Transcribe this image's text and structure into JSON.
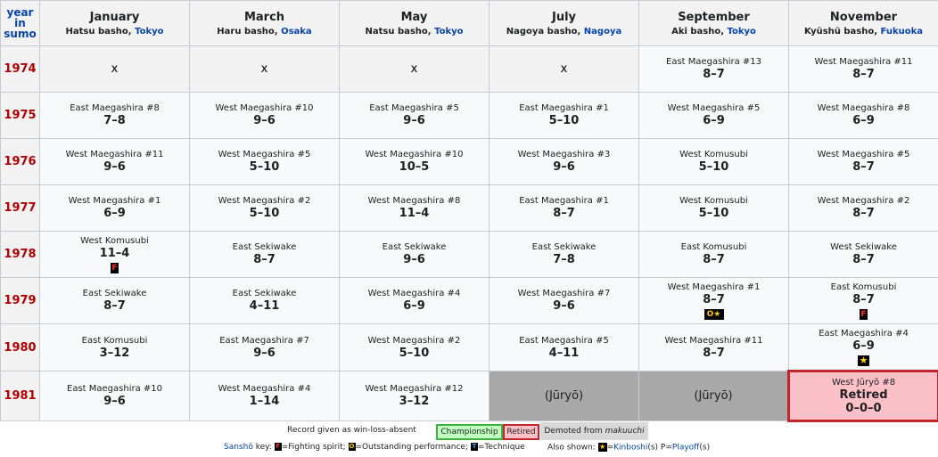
{
  "header": {
    "year_line1": "year",
    "year_line2": "in",
    "year_line3": "sumo",
    "months": [
      {
        "name": "January",
        "basho": "Hatsu basho, ",
        "venue": "Tokyo"
      },
      {
        "name": "March",
        "basho": "Haru basho, ",
        "venue": "Osaka"
      },
      {
        "name": "May",
        "basho": "Natsu basho, ",
        "venue": "Tokyo"
      },
      {
        "name": "July",
        "basho": "Nagoya basho, ",
        "venue": "Nagoya"
      },
      {
        "name": "September",
        "basho": "Aki basho, ",
        "venue": "Tokyo"
      },
      {
        "name": "November",
        "basho": "Kyūshū basho, ",
        "venue": "Fukuoka"
      }
    ]
  },
  "rows": [
    {
      "year": "1974",
      "cells": [
        {
          "type": "absent",
          "mark": "x"
        },
        {
          "type": "absent",
          "mark": "x"
        },
        {
          "type": "absent",
          "mark": "x"
        },
        {
          "type": "absent",
          "mark": "x"
        },
        {
          "type": "normal",
          "rank": "East Maegashira #13",
          "score": "8–7"
        },
        {
          "type": "normal",
          "rank": "West Maegashira #11",
          "score": "8–7"
        }
      ]
    },
    {
      "year": "1975",
      "cells": [
        {
          "type": "normal",
          "rank": "East Maegashira #8",
          "score": "7–8"
        },
        {
          "type": "normal",
          "rank": "West Maegashira #10",
          "score": "9–6"
        },
        {
          "type": "normal",
          "rank": "East Maegashira #5",
          "score": "9–6"
        },
        {
          "type": "normal",
          "rank": "East Maegashira #1",
          "score": "5–10"
        },
        {
          "type": "normal",
          "rank": "West Maegashira #5",
          "score": "6–9"
        },
        {
          "type": "normal",
          "rank": "West Maegashira #8",
          "score": "6–9"
        }
      ]
    },
    {
      "year": "1976",
      "cells": [
        {
          "type": "normal",
          "rank": "West Maegashira #11",
          "score": "9–6"
        },
        {
          "type": "normal",
          "rank": "West Maegashira #5",
          "score": "5–10"
        },
        {
          "type": "normal",
          "rank": "West Maegashira #10",
          "score": "10–5"
        },
        {
          "type": "normal",
          "rank": "West Maegashira #3",
          "score": "9–6"
        },
        {
          "type": "normal",
          "rank": "West Komusubi",
          "score": "5–10"
        },
        {
          "type": "normal",
          "rank": "West Maegashira #5",
          "score": "8–7"
        }
      ]
    },
    {
      "year": "1977",
      "cells": [
        {
          "type": "normal",
          "rank": "West Maegashira #1",
          "score": "6–9"
        },
        {
          "type": "normal",
          "rank": "West Maegashira #2",
          "score": "5–10"
        },
        {
          "type": "normal",
          "rank": "West Maegashira #8",
          "score": "11–4"
        },
        {
          "type": "normal",
          "rank": "East Maegashira #1",
          "score": "8–7"
        },
        {
          "type": "normal",
          "rank": "West Komusubi",
          "score": "5–10"
        },
        {
          "type": "normal",
          "rank": "West Maegashira #2",
          "score": "8–7"
        }
      ]
    },
    {
      "year": "1978",
      "cells": [
        {
          "type": "normal",
          "rank": "West Komusubi",
          "score": "11–4",
          "badge": "F"
        },
        {
          "type": "normal",
          "rank": "East Sekiwake",
          "score": "8–7"
        },
        {
          "type": "normal",
          "rank": "East Sekiwake",
          "score": "9–6"
        },
        {
          "type": "normal",
          "rank": "East Sekiwake",
          "score": "7–8"
        },
        {
          "type": "normal",
          "rank": "East Komusubi",
          "score": "8–7"
        },
        {
          "type": "normal",
          "rank": "West Sekiwake",
          "score": "8–7"
        }
      ]
    },
    {
      "year": "1979",
      "cells": [
        {
          "type": "normal",
          "rank": "East Sekiwake",
          "score": "8–7"
        },
        {
          "type": "normal",
          "rank": "East Sekiwake",
          "score": "4–11"
        },
        {
          "type": "normal",
          "rank": "West Maegashira #4",
          "score": "6–9"
        },
        {
          "type": "normal",
          "rank": "West Maegashira #7",
          "score": "9–6"
        },
        {
          "type": "normal",
          "rank": "West Maegashira #1",
          "score": "8–7",
          "badge": "O★"
        },
        {
          "type": "normal",
          "rank": "East Komusubi",
          "score": "8–7",
          "badge": "F"
        }
      ]
    },
    {
      "year": "1980",
      "cells": [
        {
          "type": "normal",
          "rank": "East Komusubi",
          "score": "3–12"
        },
        {
          "type": "normal",
          "rank": "East Maegashira #7",
          "score": "9–6"
        },
        {
          "type": "normal",
          "rank": "West Maegashira #2",
          "score": "5–10"
        },
        {
          "type": "normal",
          "rank": "East Maegashira #5",
          "score": "4–11"
        },
        {
          "type": "normal",
          "rank": "West Maegashira #11",
          "score": "8–7"
        },
        {
          "type": "normal",
          "rank": "East Maegashira #4",
          "score": "6–9",
          "badge": "★"
        }
      ]
    },
    {
      "year": "1981",
      "cells": [
        {
          "type": "normal",
          "rank": "East Maegashira #10",
          "score": "9–6"
        },
        {
          "type": "normal",
          "rank": "West Maegashira #4",
          "score": "1–14"
        },
        {
          "type": "normal",
          "rank": "West Maegashira #12",
          "score": "3–12"
        },
        {
          "type": "juryo",
          "text": "(Jūryō)"
        },
        {
          "type": "juryo",
          "text": "(Jūryō)"
        },
        {
          "type": "retired",
          "rank": "West Jūryō #8",
          "label": "Retired",
          "score": "0–0–0"
        }
      ]
    }
  ],
  "legend": {
    "record_text": "Record given as win-loss-absent",
    "championship": "Championship",
    "retired": "Retired",
    "demoted_prefix": "Demoted from ",
    "demoted_term": "makuuchi",
    "sansho": "Sanshō",
    "key_label": " key: ",
    "f_glyph": "F",
    "f_text": "=Fighting spirit; ",
    "o_glyph": "O",
    "o_text": "=Outstanding performance; ",
    "t_glyph": "T",
    "t_text": "=Technique",
    "also_shown": "Also shown: ",
    "star_glyph": "★",
    "equals": "=",
    "kinboshi": "Kinboshi",
    "kinboshi_suffix": "(s) P=",
    "playoff": "Playoff",
    "playoff_suffix": "(s)"
  }
}
